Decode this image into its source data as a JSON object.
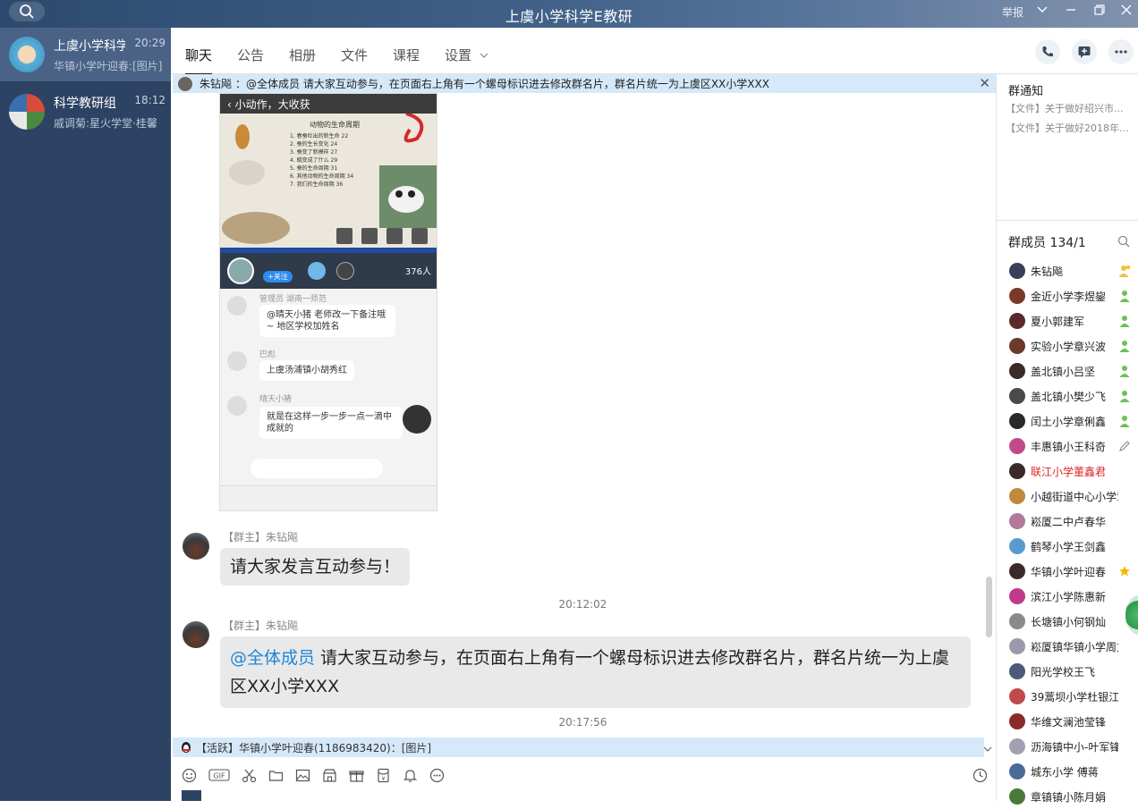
{
  "window": {
    "title": "上虞小学科学E教研",
    "report_label": "举报"
  },
  "sidebar": {
    "conversations": [
      {
        "name": "上虞小学科学",
        "time": "20:29",
        "preview": "华镇小学叶迎春:[图片]",
        "active": true
      },
      {
        "name": "科学教研组",
        "time": "18:12",
        "preview": "戚调菊:星火学堂·桂馨"
      }
    ]
  },
  "tabs": [
    {
      "label": "聊天",
      "active": true
    },
    {
      "label": "公告"
    },
    {
      "label": "相册"
    },
    {
      "label": "文件"
    },
    {
      "label": "课程"
    },
    {
      "label": "设置"
    }
  ],
  "pinned": {
    "sender": "朱钻飚",
    "text": "：@全体成员 请大家互动参与，在页面右上角有一个螺母标识进去修改群名片，群名片统一为上虞区XX小学XXX"
  },
  "screenshot_image": {
    "topbar_text": "小动作，大收获",
    "toc_title": "动物的生命周期",
    "toc_items": [
      "1. 春蚕吐出的新生命 22",
      "2. 蚕的生长变化 24",
      "3. 蚕变了新模样 27",
      "4. 蛾变成了什么 29",
      "5. 蚕的生命周期 31",
      "6. 其他动物的生命周期 34",
      "7. 我们的生命周期 36"
    ],
    "viewers": "376人",
    "follow": "+关注",
    "messages": [
      {
        "name": "管理员 湖南一师范",
        "text": "@晴天小猪 老师改一下备注哦~ 地区学校加姓名"
      },
      {
        "name": "巴彪",
        "text": "上虞汤浦镇小胡秀红"
      },
      {
        "name": "晴天小猪",
        "text": "就是在这样一步一步一点一滴中成就的"
      }
    ]
  },
  "messages": [
    {
      "sender": "【群主】朱钻飚",
      "text": "请大家发言互动参与！"
    },
    {
      "timestamp": "20:12:02"
    },
    {
      "sender": "【群主】朱钻飚",
      "at": "@全体成员",
      "text": " 请大家互动参与，在页面右上角有一个螺母标识进去修改群名片，群名片统一为上虞区XX小学XXX"
    },
    {
      "timestamp": "20:17:56"
    }
  ],
  "active_bar": "【活跃】华镇小学叶迎春(1186983420)：[图片]",
  "right_panel": {
    "notice_title": "群通知",
    "notices": [
      "【文件】关于做好绍兴市...",
      "【文件】关于做好2018年..."
    ],
    "members_title": "群成员 134/1",
    "members": [
      {
        "name": "朱钻飚",
        "role": "owner-icon"
      },
      {
        "name": "金近小学李煜鋆",
        "role": "admin-icon"
      },
      {
        "name": "夏小郭建军",
        "role": "admin-icon"
      },
      {
        "name": "实验小学章兴波",
        "role": "admin-icon"
      },
      {
        "name": "盖北镇小吕坚",
        "role": "admin-icon"
      },
      {
        "name": "盖北镇小樊少飞",
        "role": "admin-icon"
      },
      {
        "name": "闰土小学章俐鑫",
        "role": "admin-icon"
      },
      {
        "name": "丰惠镇小王科奇",
        "role": "edit-icon"
      },
      {
        "name": "联江小学董鑫君",
        "role": "",
        "highlight": "#e02424"
      },
      {
        "name": "小越街道中心小学章",
        "role": ""
      },
      {
        "name": "崧厦二中卢春华",
        "role": ""
      },
      {
        "name": "鹤琴小学王剑鑫",
        "role": ""
      },
      {
        "name": "华镇小学叶迎春",
        "role": "star-icon"
      },
      {
        "name": "滨江小学陈惠新",
        "role": ""
      },
      {
        "name": "长塘镇小何钢灿",
        "role": ""
      },
      {
        "name": "崧厦镇华镇小学周文",
        "role": ""
      },
      {
        "name": "阳光学校王飞",
        "role": ""
      },
      {
        "name": "39蒿坝小学杜银江",
        "role": ""
      },
      {
        "name": "华维文澜池莹锋",
        "role": ""
      },
      {
        "name": "沥海镇中小-叶军锋",
        "role": ""
      },
      {
        "name": "城东小学 傅蒋",
        "role": ""
      },
      {
        "name": "章镇镇小陈月娟",
        "role": ""
      }
    ]
  },
  "colors": {
    "sidebar": "#2d4363",
    "active_conv": "#4a6286",
    "pinned_bar": "#d5e9fa",
    "mention": "#1e86d8"
  }
}
